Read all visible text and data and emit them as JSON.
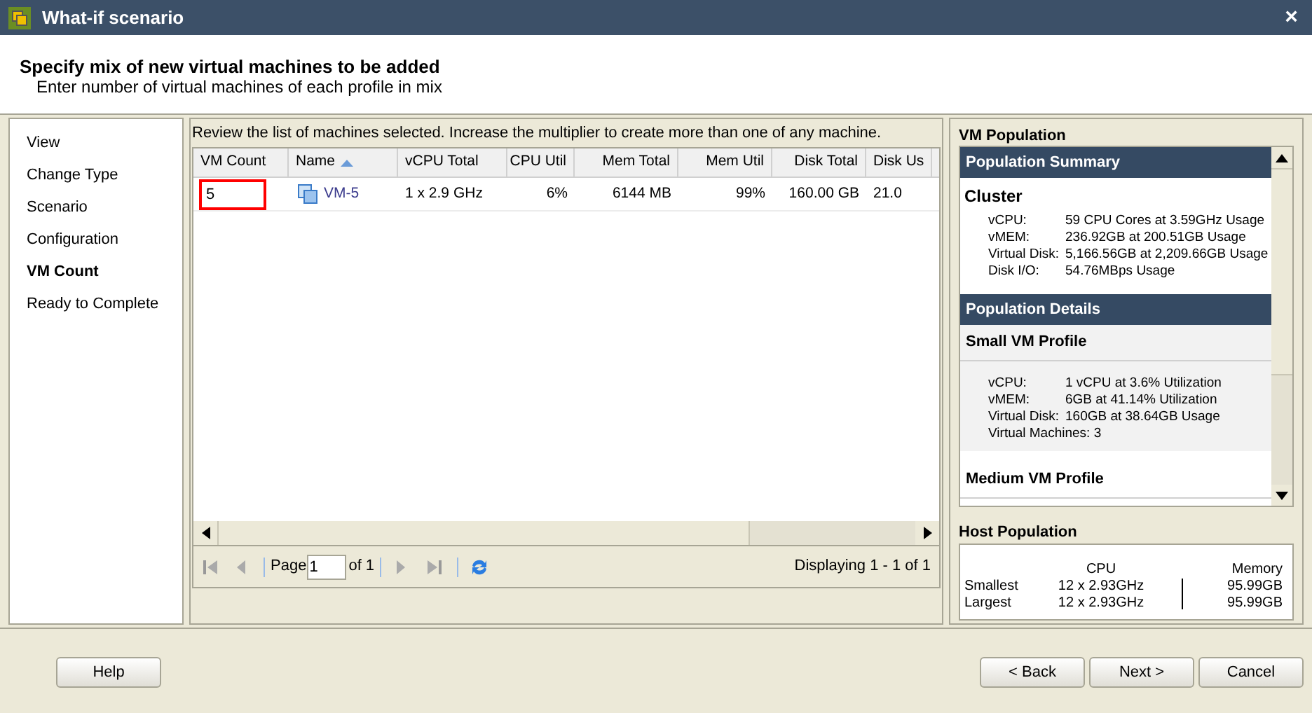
{
  "window": {
    "title": "What-if scenario",
    "close": "×"
  },
  "header": {
    "title": "Specify mix of new virtual machines to be added",
    "subtitle": "Enter number of virtual machines of each profile in mix"
  },
  "steps": [
    {
      "label": "View",
      "selected": false
    },
    {
      "label": "Change Type",
      "selected": false
    },
    {
      "label": "Scenario",
      "selected": false
    },
    {
      "label": "Configuration",
      "selected": false
    },
    {
      "label": "VM Count",
      "selected": true
    },
    {
      "label": "Ready to Complete",
      "selected": false
    }
  ],
  "grid": {
    "instruction": "Review the list of machines selected. Increase the multiplier to create more than one of any machine.",
    "columns": [
      {
        "label": "VM Count",
        "sorted": false
      },
      {
        "label": "Name",
        "sorted": true
      },
      {
        "label": "vCPU Total",
        "sorted": false
      },
      {
        "label": "CPU Util",
        "sorted": false
      },
      {
        "label": "Mem Total",
        "sorted": false
      },
      {
        "label": "Mem Util",
        "sorted": false
      },
      {
        "label": "Disk Total",
        "sorted": false
      },
      {
        "label": "Disk Us",
        "sorted": false
      }
    ],
    "rows": [
      {
        "invalid": true,
        "cells": [
          "5",
          "VM-5",
          "1 x 2.9 GHz",
          "6%",
          "6144 MB",
          "99%",
          "160.00 GB",
          "21.0"
        ]
      }
    ]
  },
  "pager": {
    "page_label": "Page",
    "page": "1",
    "of": "of 1",
    "displaying": "Displaying 1 - 1 of 1"
  },
  "population": {
    "title": "VM Population",
    "summary_header": "Population Summary",
    "cluster": "Cluster",
    "cluster_stats": [
      {
        "label": "vCPU:",
        "value": "59 CPU Cores at 3.59GHz Usage"
      },
      {
        "label": "vMEM:",
        "value": "236.92GB at 200.51GB Usage"
      },
      {
        "label": "Virtual Disk:",
        "value": "5,166.56GB at 2,209.66GB Usage"
      },
      {
        "label": "Disk I/O:",
        "value": "54.76MBps Usage"
      }
    ],
    "details_header": "Population Details",
    "profiles": [
      {
        "name": "Small VM Profile",
        "stats": [
          {
            "label": "vCPU:",
            "value": "1 vCPU at 3.6% Utilization"
          },
          {
            "label": "vMEM:",
            "value": "6GB at 41.14% Utilization"
          },
          {
            "label": "Virtual Disk:",
            "value": "160GB at 38.64GB Usage"
          },
          {
            "label": "Virtual Machines: 3"
          }
        ]
      },
      {
        "name": "Medium VM Profile"
      }
    ]
  },
  "host_population": {
    "title": "Host Population",
    "columns": [
      "CPU",
      "Memory"
    ],
    "rows": [
      {
        "label": "Smallest",
        "cpu": "12 x 2.93GHz",
        "memory": "95.99GB"
      },
      {
        "label": "Largest",
        "cpu": "12 x 2.93GHz",
        "memory": "95.99GB"
      }
    ]
  },
  "buttons": {
    "help": "Help",
    "back": "< Back",
    "next": "Next >",
    "cancel": "Cancel"
  }
}
